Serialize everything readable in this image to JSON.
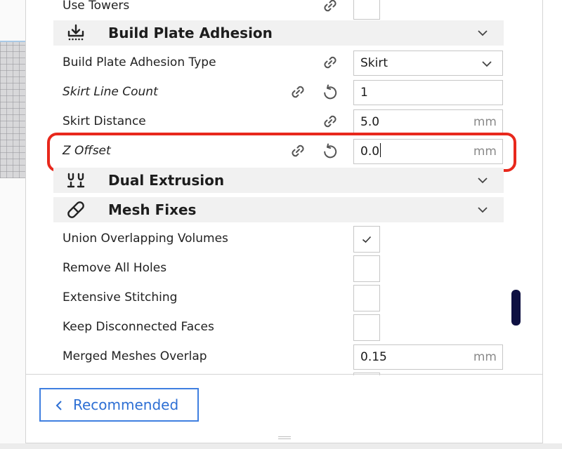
{
  "settings": {
    "use_towers_label": "Use Towers",
    "adhesion": {
      "title": "Build Plate Adhesion",
      "icon": "adhesion-icon",
      "type_label": "Build Plate Adhesion Type",
      "type_value": "Skirt",
      "skirt_line_count_label": "Skirt Line Count",
      "skirt_line_count_value": "1",
      "skirt_distance_label": "Skirt Distance",
      "skirt_distance_value": "5.0",
      "skirt_distance_unit": "mm",
      "z_offset_label": "Z Offset",
      "z_offset_value": "0.0",
      "z_offset_unit": "mm"
    },
    "dual_extrusion": {
      "title": "Dual Extrusion",
      "icon": "dual-extrusion-icon"
    },
    "mesh_fixes": {
      "title": "Mesh Fixes",
      "icon": "bandage-icon",
      "union_label": "Union Overlapping Volumes",
      "union_checked": true,
      "remove_holes_label": "Remove All Holes",
      "remove_holes_checked": false,
      "extensive_stitching_label": "Extensive Stitching",
      "extensive_stitching_checked": false,
      "keep_disconnected_label": "Keep Disconnected Faces",
      "keep_disconnected_checked": false,
      "merged_overlap_label": "Merged Meshes Overlap",
      "merged_overlap_value": "0.15",
      "merged_overlap_unit": "mm"
    }
  },
  "footer": {
    "recommended_label": "Recommended"
  },
  "colors": {
    "highlight": "#e8281c",
    "accent": "#2d6fd4",
    "scrollbar": "#0e1042"
  }
}
